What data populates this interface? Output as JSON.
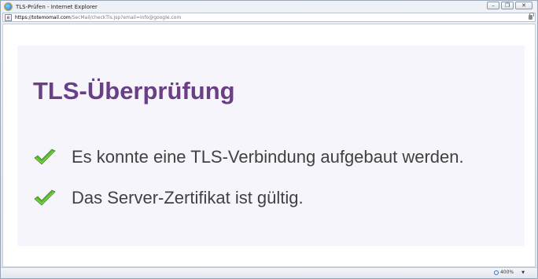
{
  "window": {
    "title": "TLS-Prüfen - Internet Explorer",
    "minimize_glyph": "–",
    "restore_glyph": "❐",
    "close_glyph": "✕"
  },
  "address_bar": {
    "url_host": "https://totemomail.com",
    "url_path": "/SecMail/checkTls.jsp?email=info@google.com",
    "security_icon": "lock-icon"
  },
  "page": {
    "heading": "TLS-Überprüfung",
    "results": [
      {
        "icon": "check-icon",
        "text": "Es konnte eine TLS-Verbindung aufgebaut werden."
      },
      {
        "icon": "check-icon",
        "text": "Das Server-Zertifikat ist gültig."
      }
    ]
  },
  "status_bar": {
    "zoom_level": "400%",
    "zoom_dropdown_glyph": "▼"
  },
  "colors": {
    "heading": "#6a3f86",
    "panel_bg": "#f6f5fb",
    "check_green": "#5bb531",
    "text": "#414141"
  }
}
